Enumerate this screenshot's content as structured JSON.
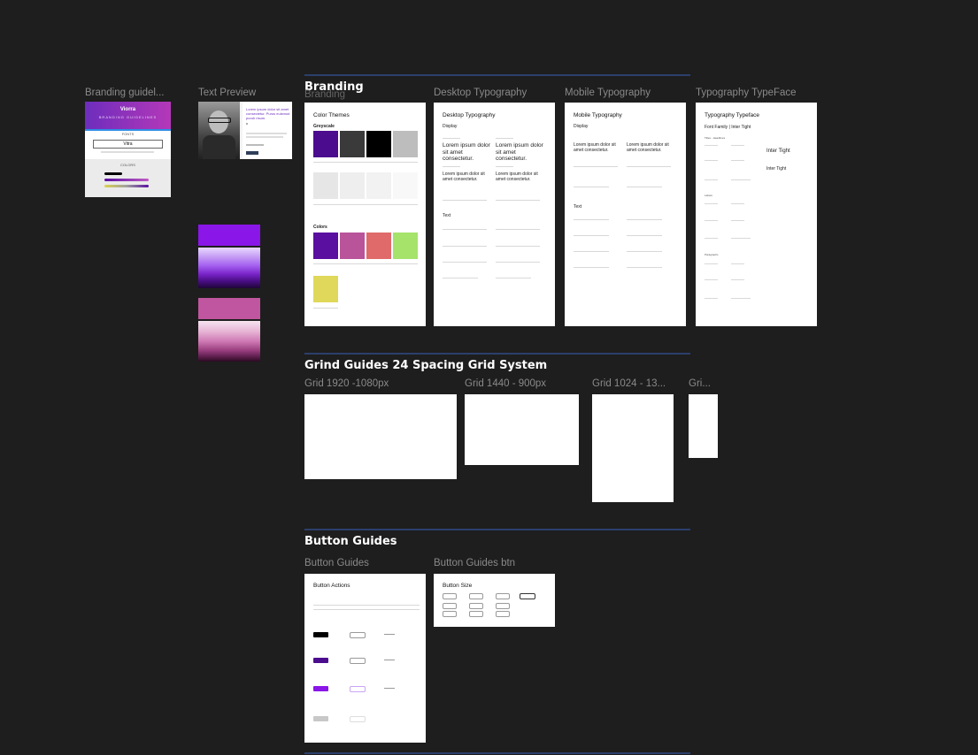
{
  "labels": {
    "branding_guidelines": "Branding guidel...",
    "text_preview": "Text Preview",
    "branding": "Branding",
    "desktop_typography": "Desktop Typography",
    "mobile_typography": "Mobile Typography",
    "typography_typeface": "Typography TypeFace",
    "grid_1920": "Grid 1920 -1080px",
    "grid_1440": "Grid 1440 - 900px",
    "grid_1024": "Grid 1024 - 13...",
    "grid_small": "Gri...",
    "button_guides": "Button Guides",
    "button_guides_btn": "Button Guides btn"
  },
  "sections": {
    "branding": "Branding",
    "grid": "Grind Guides 24 Spacing Grid System",
    "buttons": "Button Guides"
  },
  "branding_card": {
    "brand": "Viorra",
    "tagline": "BRANDING GUIDELINES",
    "fonts": "FONTS",
    "font_sample": "Vitra",
    "colors": "COLORS"
  },
  "text_preview": {
    "headline": "Lorem ipsum dolor sit amet consectetur. Purus euismod puruh risum.",
    "quote_mark": "“"
  },
  "branding_frame": {
    "title": "Color Themes",
    "grayscale": "Greyscale",
    "colors": "Colors"
  },
  "desktop_frame": {
    "title": "Desktop Typography",
    "display": "Display",
    "sample_big": "Lorem ipsum dolor sit amet consectetur.",
    "sample_med": "Lorem ipsum dolor sit amet consectetur.",
    "text": "Text"
  },
  "mobile_frame": {
    "title": "Mobile Typography",
    "display": "Display",
    "sample": "Lorem ipsum dolor sit amet consectetur.",
    "text": "Text"
  },
  "typeface_frame": {
    "title": "Typography Typeface",
    "family": "Font Family | Inter Tight",
    "sample1": "Inter Tight",
    "sample2": "Inter Tight",
    "titles": "Titles - Headlines",
    "labels": "Labels",
    "paragraphs": "Paragraphs"
  },
  "button_frame": {
    "title": "Button Actions"
  },
  "button_size_frame": {
    "title": "Button Size"
  },
  "colors": {
    "canvas": "#1e1e1e",
    "purple": "#5a0fa0",
    "pink": "#b9539a",
    "salmon": "#e06a6a",
    "green": "#a6e36b",
    "yellow": "#e0d85a",
    "selection": "#2f8de4",
    "rule": "#2c3f6b"
  }
}
